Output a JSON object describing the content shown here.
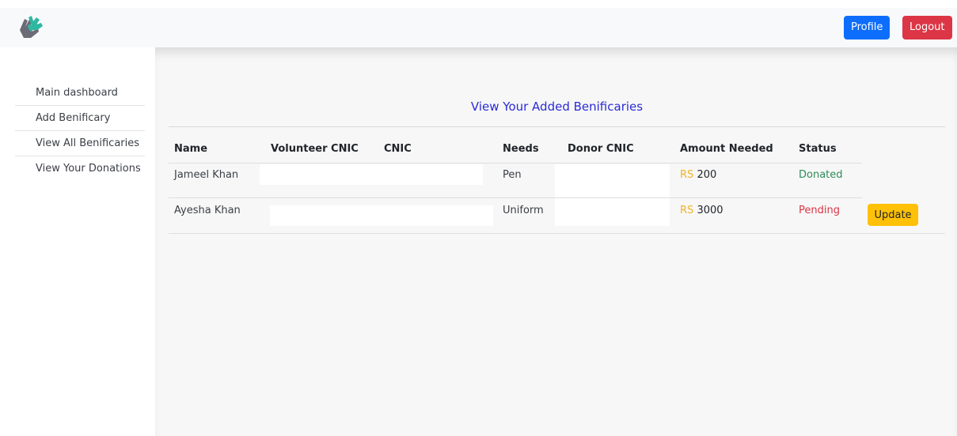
{
  "navbar": {
    "logo_icon": "helping-hands-heart-logo",
    "profile_label": "Profile",
    "logout_label": "Logout",
    "colors": {
      "profile": "#0d6efd",
      "logout": "#dc3545"
    }
  },
  "sidebar": {
    "items": [
      {
        "label": "Main dashboard"
      },
      {
        "label": "Add Benificary"
      },
      {
        "label": "View All Benificaries"
      },
      {
        "label": "View Your Donations"
      }
    ]
  },
  "main": {
    "title": "View Your Added Benificaries",
    "table": {
      "headers": [
        "Name",
        "Volunteer CNIC",
        "CNIC",
        "Needs",
        "Donor CNIC",
        "Amount Needed",
        "Status"
      ],
      "currency": "RS",
      "rows": [
        {
          "name": "Jameel Khan",
          "volunteer_cnic": "",
          "cnic": "",
          "needs": "Pen",
          "donor_cnic": "",
          "amount": "200",
          "status": "Donated",
          "action": ""
        },
        {
          "name": "Ayesha Khan",
          "volunteer_cnic": "",
          "cnic": "",
          "needs": "Uniform",
          "donor_cnic": "",
          "amount": "3000",
          "status": "Pending",
          "action": "Update"
        }
      ]
    },
    "status_colors": {
      "Donated": "#2e8b57",
      "Pending": "#dc3545",
      "currency": "#f0b429"
    }
  }
}
